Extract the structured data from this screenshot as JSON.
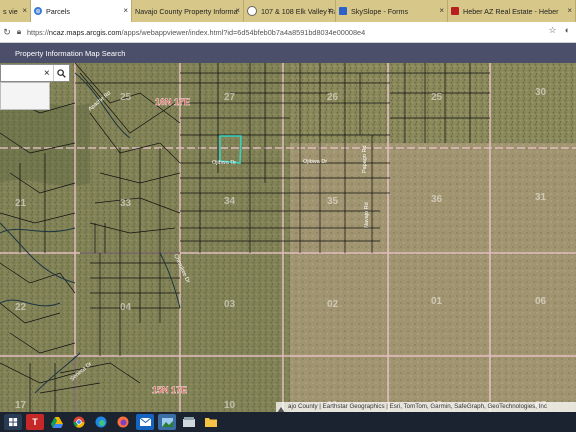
{
  "browser": {
    "tabs": [
      {
        "label": "s vie",
        "close": "×"
      },
      {
        "label": "Parcels",
        "close": "×"
      },
      {
        "label": "Navajo County Property Informa",
        "close": "×"
      },
      {
        "label": "107 & 108 Elk Valley Ranch",
        "close": "×"
      },
      {
        "label": "SkySlope - Forms",
        "close": "×"
      },
      {
        "label": "Heber AZ Real Estate - Heber",
        "close": "×"
      }
    ],
    "url_host": "ncaz.maps.arcgis.com",
    "url_prefix": "https://",
    "url_path": "/apps/webappviewer/index.html?id=6d54bfeb0b7a4a8591bd8034e00008e4"
  },
  "app": {
    "title": "Property Information Map Search"
  },
  "search": {
    "value": "",
    "clear": "×"
  },
  "map": {
    "township_labels": [
      "16N 17E",
      "15N 17E"
    ],
    "section_labels": [
      "27",
      "26",
      "25",
      "30",
      "34",
      "35",
      "36",
      "31",
      "03",
      "02",
      "01",
      "06",
      "33",
      "25",
      "28",
      "21",
      "04",
      "22",
      "10",
      "11",
      "12",
      "07",
      "17"
    ],
    "road_labels": [
      "Ojibwa Dr",
      "Ojibwa Dr",
      "Papago Rd",
      "Navajo Rd",
      "Apache Rd",
      "Cherokee Dr",
      "Seneca Dr"
    ],
    "attribution": "ajo County | Earthstar Geographics | Esri, TomTom, Garmin, SafeGraph, GeoTechnologies, Inc"
  },
  "taskbar": {
    "items": [
      "start",
      "T",
      "drive",
      "chrome",
      "edge",
      "firefox",
      "mail",
      "photos",
      "storage",
      "folder"
    ]
  }
}
